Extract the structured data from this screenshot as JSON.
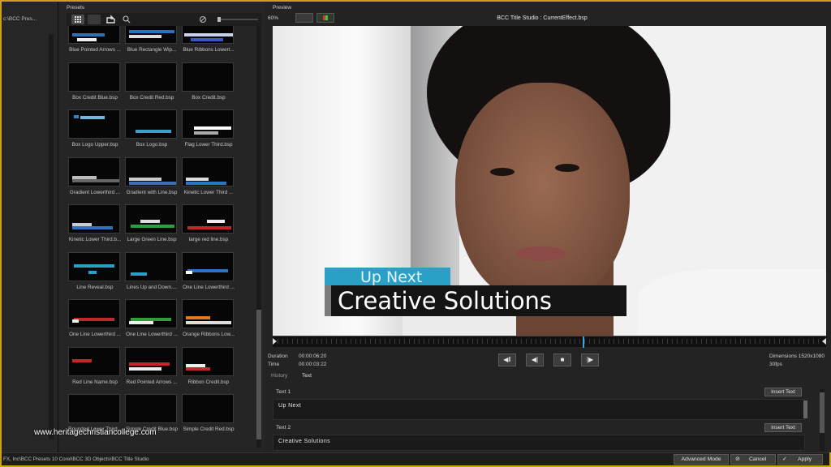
{
  "window": {
    "title": "BCC Title Studio : CurrentEffect.bsp"
  },
  "tree": {
    "path_label": "c:\\BCC Pres..."
  },
  "presets": {
    "title": "Presets",
    "items": [
      {
        "label": "Blue Pointed Arrows ...",
        "style": "arrows-blue"
      },
      {
        "label": "Blue Rectangle Wip...",
        "style": "rect-blue"
      },
      {
        "label": "Blue Ribbons Lowert...",
        "style": "ribbons-blue"
      },
      {
        "label": "Box Credit Blue.bsp",
        "style": "blank"
      },
      {
        "label": "Box Credit Red.bsp",
        "style": "blank"
      },
      {
        "label": "Box Credit.bsp",
        "style": "blank"
      },
      {
        "label": "Box Logo Upper.bsp",
        "style": "logo-upper"
      },
      {
        "label": "Box Logo.bsp",
        "style": "logo"
      },
      {
        "label": "Flag Lower Third.bsp",
        "style": "flag"
      },
      {
        "label": "Gradient Lowerthird ...",
        "style": "gradient"
      },
      {
        "label": "Gradient with Line.bsp",
        "style": "gradient-line"
      },
      {
        "label": "Kinetic Lower Third ...",
        "style": "kinetic"
      },
      {
        "label": "Kinetic Lower Third.b...",
        "style": "kinetic2"
      },
      {
        "label": "Large Green Line.bsp",
        "style": "green"
      },
      {
        "label": "large red line.bsp",
        "style": "red"
      },
      {
        "label": "Line Reveal.bsp",
        "style": "reveal"
      },
      {
        "label": "Lines Up and Down....",
        "style": "lines"
      },
      {
        "label": "One Line Lowerthird ...",
        "style": "oneline-blue"
      },
      {
        "label": "One Line Lowerthird ...",
        "style": "oneline-red"
      },
      {
        "label": "One Line Lowerthird ...",
        "style": "oneline-green"
      },
      {
        "label": "Orange Ribbons Low...",
        "style": "orange"
      },
      {
        "label": "Red Line Name.bsp",
        "style": "redname"
      },
      {
        "label": "Red Pointed Arrows ...",
        "style": "redarrows"
      },
      {
        "label": "Ribbon Credit.bsp",
        "style": "ribbon"
      },
      {
        "label": "Rounded Lower Third...",
        "style": "blank"
      },
      {
        "label": "Simple Credit Blue.bsp",
        "style": "blank"
      },
      {
        "label": "Simple Credit Red.bsp",
        "style": "blank"
      }
    ]
  },
  "preview": {
    "title": "Preview",
    "zoom": "60%",
    "lower_third": {
      "line1": "Up Next",
      "line2": "Creative Solutions"
    },
    "duration_label": "Duration",
    "duration_value": "00:00:06:20",
    "time_label": "Time",
    "time_value": "00:00:03:22",
    "dimensions": "Dimensions 1520x1080",
    "fps": "30fps",
    "transport": [
      "step-back-to-start",
      "step-back",
      "stop",
      "play"
    ]
  },
  "text_panel": {
    "tabs": [
      "History",
      "Text"
    ],
    "active_tab": "Text",
    "fields": [
      {
        "label": "Text 1",
        "value": "Up Next",
        "button": "Insert Text"
      },
      {
        "label": "Text 2",
        "value": "Creative Solutions",
        "button": "Insert Text"
      }
    ]
  },
  "status": {
    "path": "FX, Inc\\BCC Presets 10 Corel\\BCC 3D Objects\\BCC Title Studio",
    "advanced_mode": "Advanced Mode",
    "cancel": "Cancel",
    "apply": "Apply"
  },
  "watermark": "www.heritagechristiancollege.com",
  "colors": {
    "accent_blue": "#2aa0c7",
    "frame_gold": "#c9a21a",
    "timeline_cursor": "#3aa3d9"
  }
}
